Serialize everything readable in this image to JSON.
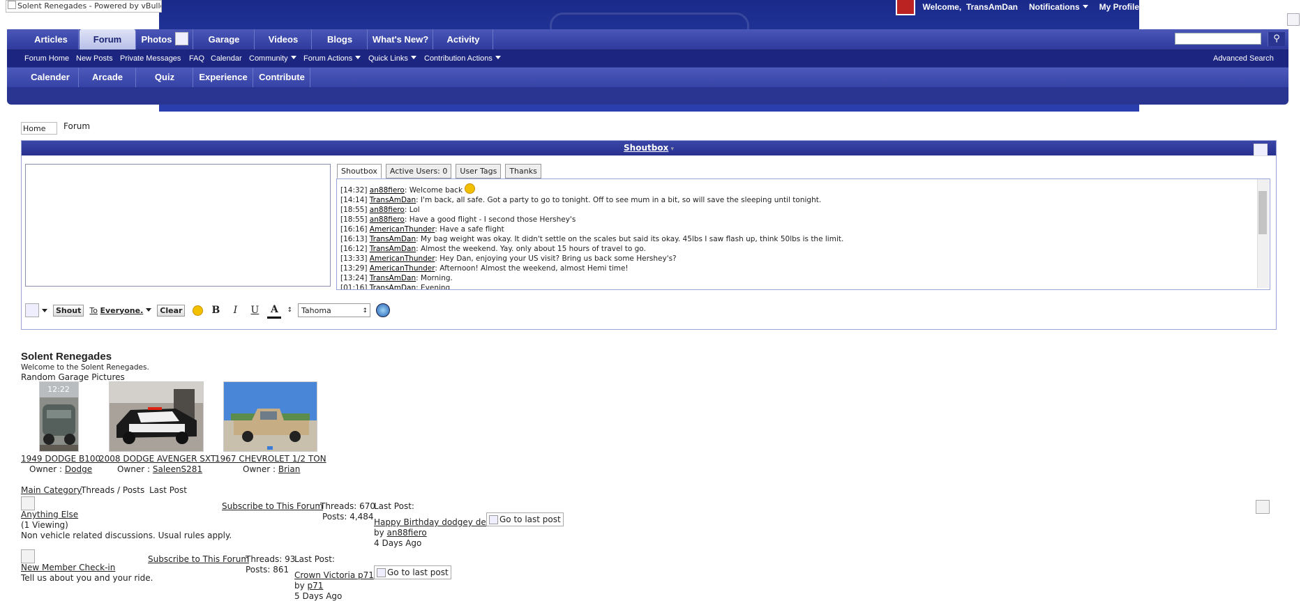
{
  "header": {
    "logo_alt": "Solent Renegades - Powered by vBulletin",
    "welcome": "Welcome,",
    "username": "TransAmDan",
    "notifications": "Notifications",
    "my_profile": "My Profile"
  },
  "nav": {
    "tabs": [
      "Articles",
      "Forum",
      "Photos",
      "Garage",
      "Videos",
      "Blogs",
      "What's New?",
      "Activity"
    ],
    "sub_links": [
      "Forum Home",
      "New Posts",
      "Private Messages",
      "FAQ",
      "Calendar",
      "Community",
      "Forum Actions",
      "Quick Links",
      "Contribution Actions"
    ],
    "advanced_search": "Advanced Search",
    "extra_tabs": [
      "Calender",
      "Arcade",
      "Quiz",
      "Experience",
      "Contribute"
    ]
  },
  "breadcrumb": {
    "home_alt": "Home",
    "current": "Forum"
  },
  "shoutbox": {
    "title": "Shoutbox",
    "tabs": [
      "Shoutbox",
      "Active Users: 0",
      "User Tags",
      "Thanks"
    ],
    "messages": [
      {
        "time": "[14:32]",
        "user": "an88fiero",
        "text": ": Welcome back"
      },
      {
        "time": "[14:14]",
        "user": "TransAmDan",
        "text": ": I'm back, all safe. Got a party to go to tonight. Off to see mum in a bit, so will save the sleeping until tonight."
      },
      {
        "time": "[18:55]",
        "user": "an88fiero",
        "text": ": Lol"
      },
      {
        "time": "[18:55]",
        "user": "an88fiero",
        "text": ": Have a good flight - I second those Hershey's"
      },
      {
        "time": "[16:16]",
        "user": "AmericanThunder",
        "text": ": Have a safe flight"
      },
      {
        "time": "[16:13]",
        "user": "TransAmDan",
        "text": ": My bag weight was okay. It didn't settle on the scales but said its okay. 45lbs I saw flash up, think 50lbs is the limit."
      },
      {
        "time": "[16:12]",
        "user": "TransAmDan",
        "text": ": Almost the weekend. Yay. only about 15 hours of travel to go."
      },
      {
        "time": "[13:33]",
        "user": "AmericanThunder",
        "text": ": Hey Dan, enjoying your US visit? Bring us back some Hershey's?"
      },
      {
        "time": "[13:29]",
        "user": "AmericanThunder",
        "text": ": Afternoon! Almost the weekend, almost Hemi time!"
      },
      {
        "time": "[13:24]",
        "user": "TransAmDan",
        "text": ": Morning."
      },
      {
        "time": "[01:16]",
        "user": "TransAmDan",
        "text": ": Evening"
      }
    ],
    "toolbar": {
      "shout": "Shout",
      "to_prefix": "To",
      "to_target": "Everyone.",
      "clear": "Clear",
      "bold": "B",
      "italic": "I",
      "underline": "U",
      "color": "A",
      "font": "Tahoma"
    }
  },
  "forum": {
    "title": "Solent Renegades",
    "description": "Welcome to the Solent Renegades.",
    "random_garage_label": "Random Garage Pictures",
    "owner_label": "Owner :",
    "garage": [
      {
        "name": "1949 DODGE B100",
        "owner": "Dodge"
      },
      {
        "name": "2008 DODGE AVENGER SXT",
        "owner": "SaleenS281"
      },
      {
        "name": "1967 CHEVROLET 1/2 TON",
        "owner": "Brian"
      }
    ],
    "columns": {
      "category": "Main Category",
      "threads_posts": "Threads / Posts",
      "last_post": "Last Post"
    },
    "subscribe_label": "Subscribe to This Forum",
    "go_last_post": "Go to last post",
    "last_post_label": "Last Post:",
    "by_label": "by",
    "forums": [
      {
        "name": "Anything Else",
        "viewing": "(1 Viewing)",
        "description": "Non vehicle related discussions. Usual rules apply.",
        "threads": "Threads: 670",
        "posts": "Posts: 4,484",
        "last_title": "Happy Birthday dodgey den",
        "last_user": "an88fiero",
        "last_time": "4 Days Ago"
      },
      {
        "name": "New Member Check-in",
        "description": "Tell us about you and your ride.",
        "threads": "Threads: 93",
        "posts": "Posts: 861",
        "last_title": "Crown Victoria p71",
        "last_user": "p71",
        "last_time": "5 Days Ago"
      }
    ]
  }
}
